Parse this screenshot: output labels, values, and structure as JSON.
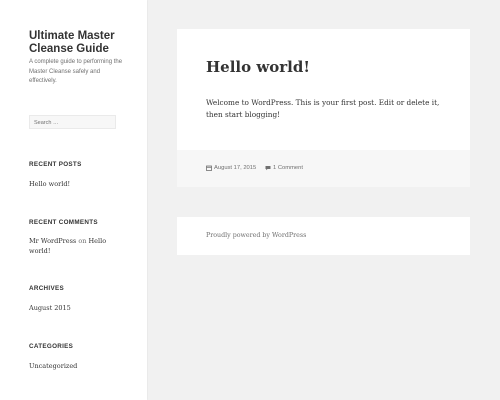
{
  "site": {
    "title": "Ultimate Master Cleanse Guide",
    "description": "A complete guide to performing the Master Cleanse safely and effectively."
  },
  "search": {
    "placeholder": "Search …"
  },
  "widgets": {
    "recent_posts": {
      "title": "RECENT POSTS",
      "items": [
        "Hello world!"
      ]
    },
    "recent_comments": {
      "title": "RECENT COMMENTS",
      "author": "Mr WordPress",
      "on_text": "on",
      "post": "Hello world!"
    },
    "archives": {
      "title": "ARCHIVES",
      "items": [
        "August 2015"
      ]
    },
    "categories": {
      "title": "CATEGORIES",
      "items": [
        "Uncategorized"
      ]
    }
  },
  "post": {
    "title": "Hello world!",
    "content": "Welcome to WordPress. This is your first post. Edit or delete it, then start blogging!",
    "date": "August 17, 2015",
    "comments": "1 Comment"
  },
  "footer": {
    "text": "Proudly powered by WordPress"
  },
  "colors": {
    "background": "#f1f1f1",
    "card": "#ffffff",
    "text": "#333333",
    "muted": "#707070"
  },
  "icons": {
    "date": "calendar-icon",
    "comments": "comment-bubble-icon"
  }
}
